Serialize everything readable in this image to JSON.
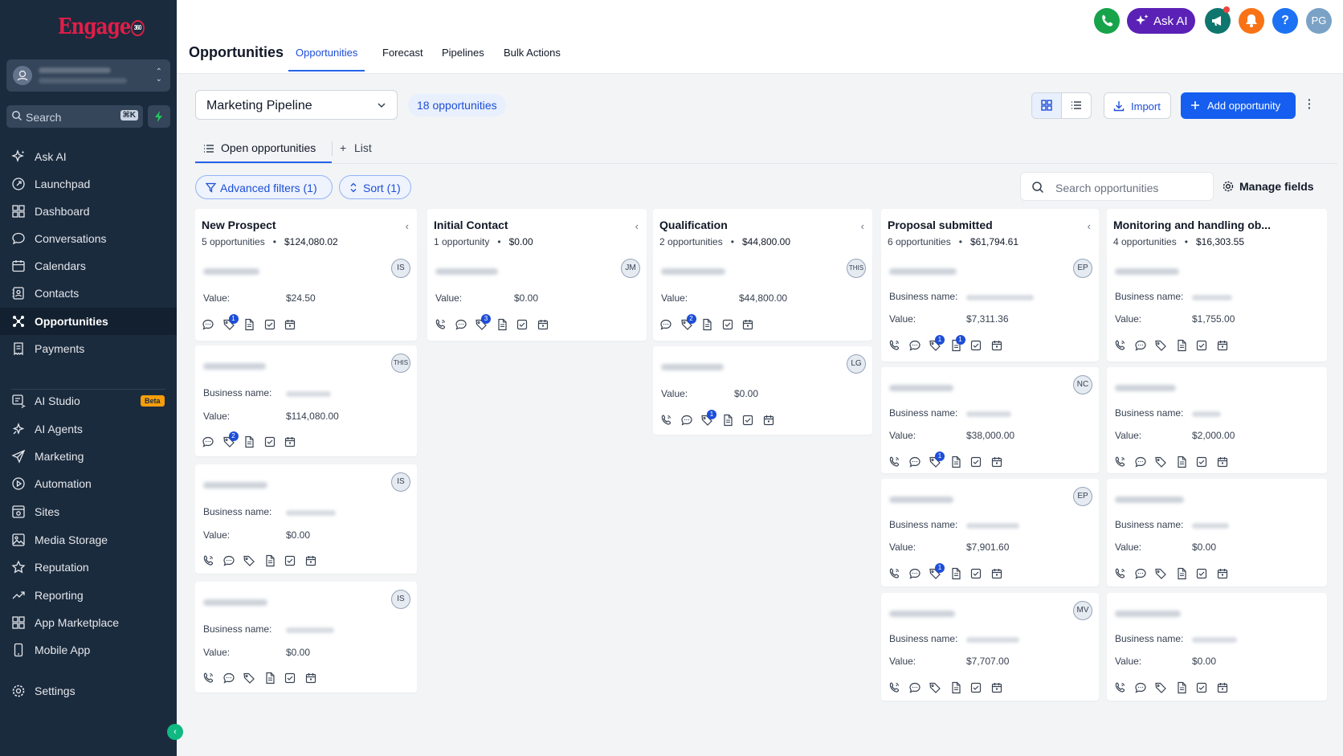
{
  "brand": {
    "logo_text": "Engage",
    "logo_badge": "360"
  },
  "sidebar": {
    "search_label": "Search",
    "search_shortcut": "⌘K",
    "items": [
      {
        "label": "Ask AI",
        "icon": "sparkle-icon"
      },
      {
        "label": "Launchpad",
        "icon": "rocket-icon"
      },
      {
        "label": "Dashboard",
        "icon": "grid-icon"
      },
      {
        "label": "Conversations",
        "icon": "chat-icon"
      },
      {
        "label": "Calendars",
        "icon": "calendar-icon"
      },
      {
        "label": "Contacts",
        "icon": "contacts-icon"
      },
      {
        "label": "Opportunities",
        "icon": "opportunities-icon"
      },
      {
        "label": "Payments",
        "icon": "receipt-icon"
      },
      {
        "label": "AI Studio",
        "icon": "ai-studio-icon",
        "badge": "Beta"
      },
      {
        "label": "AI Agents",
        "icon": "agents-icon"
      },
      {
        "label": "Marketing",
        "icon": "send-icon"
      },
      {
        "label": "Automation",
        "icon": "automation-icon"
      },
      {
        "label": "Sites",
        "icon": "sites-icon"
      },
      {
        "label": "Media Storage",
        "icon": "image-icon"
      },
      {
        "label": "Reputation",
        "icon": "star-icon"
      },
      {
        "label": "Reporting",
        "icon": "trend-icon"
      },
      {
        "label": "App Marketplace",
        "icon": "apps-icon"
      },
      {
        "label": "Mobile App",
        "icon": "mobile-icon"
      },
      {
        "label": "Settings",
        "icon": "gear-icon"
      }
    ]
  },
  "header": {
    "title": "Opportunities",
    "tabs": [
      "Opportunities",
      "Forecast",
      "Pipelines",
      "Bulk Actions"
    ],
    "ask_ai": "Ask AI",
    "help": "?",
    "user_initials": "PG"
  },
  "controls": {
    "pipeline": "Marketing Pipeline",
    "count": "18 opportunities",
    "import": "Import",
    "add": "Add opportunity",
    "subtabs": [
      "Open opportunities",
      "List"
    ],
    "filters": "Advanced filters (1)",
    "sort": "Sort (1)",
    "search_placeholder": "Search opportunities",
    "manage_fields": "Manage fields"
  },
  "labels": {
    "value": "Value:",
    "business": "Business name:",
    "dot": "•"
  },
  "columns": [
    {
      "name": "New Prospect",
      "count": "5 opportunities",
      "total": "$124,080.02",
      "cards": [
        {
          "avatar": "IS",
          "value": "$24.50",
          "biz": false,
          "icons": [
            "chat",
            "tag",
            "doc",
            "check",
            "cal"
          ],
          "badges": {
            "tag": "1"
          }
        },
        {
          "avatar": "THIS",
          "value": "$114,080.00",
          "biz": true,
          "icons": [
            "chat",
            "tag",
            "doc",
            "check",
            "cal"
          ],
          "badges": {
            "tag": "2"
          }
        },
        {
          "avatar": "IS",
          "value": "$0.00",
          "biz": true,
          "icons": [
            "phone",
            "chat",
            "tag",
            "doc",
            "check",
            "cal"
          ],
          "badges": {}
        },
        {
          "avatar": "IS",
          "value": "$0.00",
          "biz": true,
          "icons": [
            "phone",
            "chat",
            "tag",
            "doc",
            "check",
            "cal"
          ],
          "badges": {}
        }
      ]
    },
    {
      "name": "Initial Contact",
      "count": "1 opportunity",
      "total": "$0.00",
      "cards": [
        {
          "avatar": "JM",
          "value": "$0.00",
          "biz": false,
          "icons": [
            "phone",
            "chat",
            "tag",
            "doc",
            "check",
            "cal"
          ],
          "badges": {
            "tag": "3"
          }
        }
      ]
    },
    {
      "name": "Qualification",
      "count": "2 opportunities",
      "total": "$44,800.00",
      "cards": [
        {
          "avatar": "THIS",
          "value": "$44,800.00",
          "biz": false,
          "icons": [
            "chat",
            "tag",
            "doc",
            "check",
            "cal"
          ],
          "badges": {
            "tag": "2"
          }
        },
        {
          "avatar": "LG",
          "value": "$0.00",
          "biz": false,
          "icons": [
            "phone",
            "chat",
            "tag",
            "doc",
            "check",
            "cal"
          ],
          "badges": {
            "tag": "1"
          }
        }
      ]
    },
    {
      "name": "Proposal submitted",
      "count": "6 opportunities",
      "total": "$61,794.61",
      "cards": [
        {
          "avatar": "EP",
          "value": "$7,311.36",
          "biz": true,
          "icons": [
            "phone",
            "chat",
            "tag",
            "doc",
            "check",
            "cal"
          ],
          "badges": {
            "tag": "1",
            "doc": "1"
          }
        },
        {
          "avatar": "NC",
          "value": "$38,000.00",
          "biz": true,
          "icons": [
            "phone",
            "chat",
            "tag",
            "doc",
            "check",
            "cal"
          ],
          "badges": {
            "tag": "1"
          }
        },
        {
          "avatar": "EP",
          "value": "$7,901.60",
          "biz": true,
          "icons": [
            "phone",
            "chat",
            "tag",
            "doc",
            "check",
            "cal"
          ],
          "badges": {
            "tag": "1"
          }
        },
        {
          "avatar": "MV",
          "value": "$7,707.00",
          "biz": true,
          "icons": [
            "phone",
            "chat",
            "tag",
            "doc",
            "check",
            "cal"
          ],
          "badges": {}
        }
      ]
    },
    {
      "name": "Monitoring and handling ob...",
      "count": "4 opportunities",
      "total": "$16,303.55",
      "cards": [
        {
          "avatar": "",
          "value": "$1,755.00",
          "biz": true,
          "icons": [
            "phone",
            "chat",
            "tag",
            "doc",
            "check",
            "cal"
          ],
          "badges": {}
        },
        {
          "avatar": "",
          "value": "$2,000.00",
          "biz": true,
          "icons": [
            "phone",
            "chat",
            "tag",
            "doc",
            "check",
            "cal"
          ],
          "badges": {}
        },
        {
          "avatar": "",
          "value": "$0.00",
          "biz": true,
          "icons": [
            "phone",
            "chat",
            "tag",
            "doc",
            "check",
            "cal"
          ],
          "badges": {}
        },
        {
          "avatar": "",
          "value": "$0.00",
          "biz": true,
          "icons": [
            "phone",
            "chat",
            "tag",
            "doc",
            "check",
            "cal"
          ],
          "badges": {}
        }
      ]
    }
  ],
  "colors": {
    "sidebar": "#1b2b3e",
    "primary": "#155eef",
    "accent_purple": "#5b21b6",
    "phone_green": "#16a34a",
    "bell_orange": "#f97316"
  }
}
